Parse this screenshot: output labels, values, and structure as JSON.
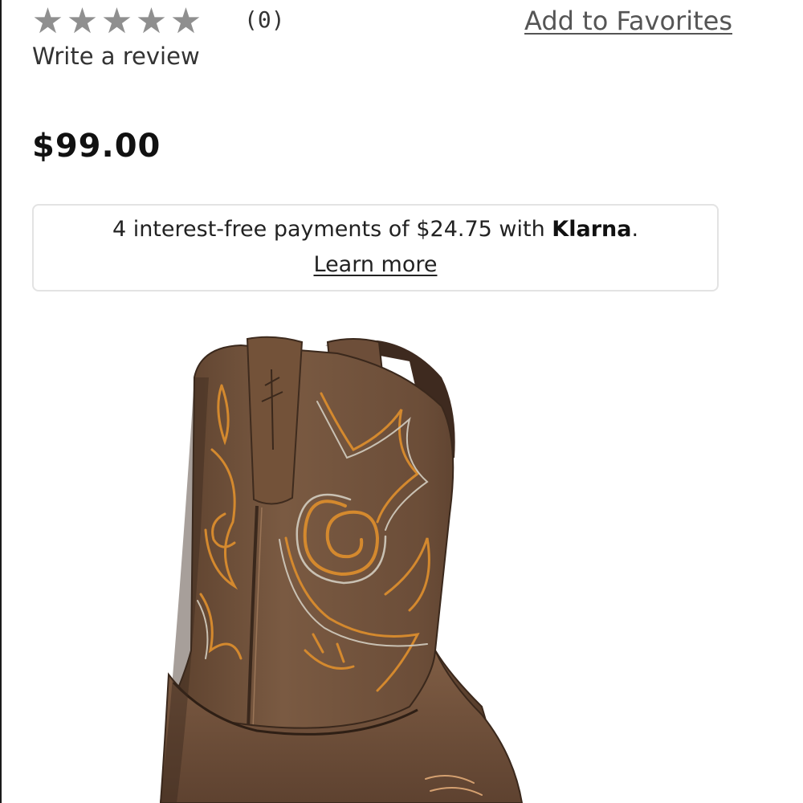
{
  "rating": {
    "stars": [
      "★",
      "★",
      "★",
      "★",
      "★"
    ],
    "count_text": "(0)",
    "write_review_label": "Write a review"
  },
  "favorites": {
    "label": "Add to Favorites"
  },
  "price": {
    "amount": "$99.00"
  },
  "klarna": {
    "text_prefix": "4 interest-free payments of $24.75 with ",
    "brand": "Klarna",
    "text_suffix": ".",
    "learn_more_label": "Learn more"
  },
  "product": {
    "image_icon": "western-boot-photo",
    "boot_color": "#7a5a42",
    "stitch_color": "#d4892e"
  }
}
